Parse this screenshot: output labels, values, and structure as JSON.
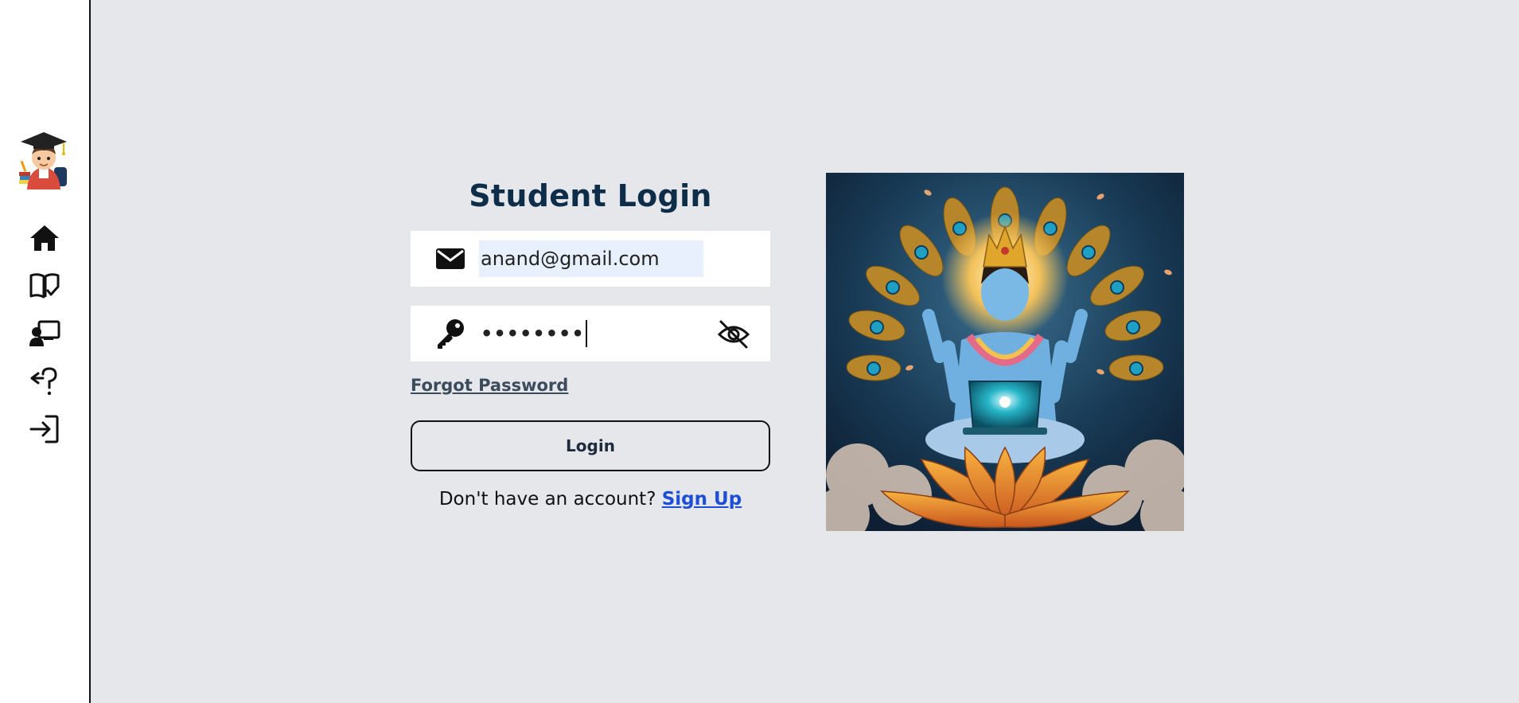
{
  "sidebar": {
    "avatar_icon": "student-graduate-avatar-icon",
    "items": [
      {
        "icon": "home-icon"
      },
      {
        "icon": "open-book-check-icon"
      },
      {
        "icon": "teacher-presentation-icon"
      },
      {
        "icon": "back-question-icon"
      },
      {
        "icon": "login-arrow-icon"
      }
    ]
  },
  "login": {
    "title": "Student Login",
    "email_value": "anand@gmail.com",
    "email_icon": "envelope-icon",
    "password_value": "••••••••",
    "password_icon": "key-icon",
    "visibility_icon": "eye-slash-icon",
    "forgot_label": "Forgot Password",
    "login_label": "Login",
    "signup_prompt": "Don't have an account?",
    "signup_label": "Sign Up"
  },
  "hero": {
    "image_icon": "deity-with-laptop-on-lotus-illustration"
  },
  "colors": {
    "background": "#e5e7eb",
    "sidebar": "#ffffff",
    "title": "#0d2d48",
    "link": "#1d4ed8",
    "autofill": "#e8f0fe"
  }
}
